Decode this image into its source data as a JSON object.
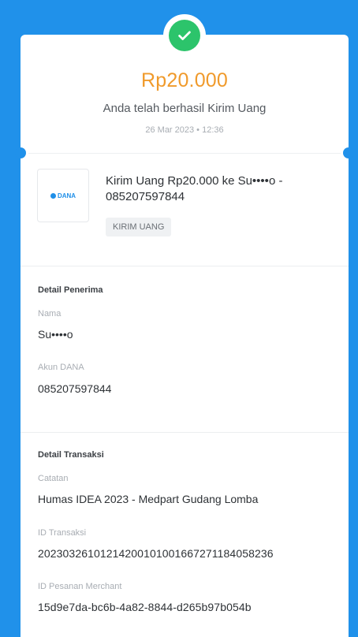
{
  "receipt": {
    "amount": "Rp20.000",
    "status_text": "Anda telah berhasil Kirim Uang",
    "datetime": "26 Mar 2023 • 12:36"
  },
  "transaction": {
    "title": "Kirim Uang Rp20.000 ke Su••••o - 085207597844",
    "chip_label": "KIRIM UANG",
    "merchant_logo_text": "DANA"
  },
  "recipient": {
    "section_title": "Detail Penerima",
    "name_label": "Nama",
    "name_value": "Su••••o",
    "account_label": "Akun DANA",
    "account_value": "085207597844"
  },
  "details": {
    "section_title": "Detail Transaksi",
    "note_label": "Catatan",
    "note_value": "Humas IDEA 2023 - Medpart Gudang Lomba",
    "tx_id_label": "ID Transaksi",
    "tx_id_value": "20230326101214200101001667271184058236",
    "merchant_order_label": "ID Pesanan Merchant",
    "merchant_order_value": "15d9e7da-bc6b-4a82-8844-d265b97b054b"
  },
  "colors": {
    "background": "#2091ea",
    "amount": "#f09a2b",
    "success": "#2cc46b"
  },
  "icons": {
    "status": "check-icon",
    "merchant": "dana-logo-icon"
  }
}
